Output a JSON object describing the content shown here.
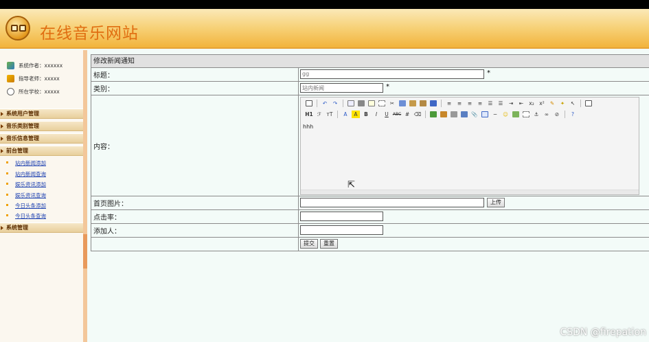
{
  "site": {
    "title": "在线音乐网站"
  },
  "sidebar": {
    "info": [
      {
        "text": "系统作者：xxxxxx",
        "icon": "person-icon"
      },
      {
        "text": "指导老师：xxxxx",
        "icon": "teacher-icon"
      },
      {
        "text": "所在学校：xxxxx",
        "icon": "school-icon"
      }
    ],
    "sections": [
      {
        "label": "系统用户管理"
      },
      {
        "label": "音乐类别管理"
      },
      {
        "label": "音乐信息管理"
      },
      {
        "label": "前台管理"
      },
      {
        "label": "系统管理"
      }
    ],
    "front_items": [
      {
        "label": "站内新闻添加"
      },
      {
        "label": "站内新闻查询"
      },
      {
        "label": "娱乐资讯添加"
      },
      {
        "label": "娱乐资讯查询"
      },
      {
        "label": "今日头条添加"
      },
      {
        "label": "今日头条查询"
      }
    ]
  },
  "form": {
    "title": "修改新闻通知",
    "fields": {
      "title_label": "标题：",
      "title_value": "gg",
      "category_label": "类别：",
      "category_value": "站内新闻",
      "content_label": "内容：",
      "content_value": "hhh",
      "image_label": "首页图片：",
      "image_value": "",
      "upload_button": "上传",
      "clicks_label": "点击率：",
      "clicks_value": "",
      "adder_label": "添加人：",
      "adder_value": "",
      "required_mark": "*"
    },
    "submit_button": "提交",
    "reset_button": "重置"
  },
  "editor": {
    "toolbar_row1": [
      "source-icon",
      "undo-icon",
      "redo-icon",
      "preview-icon",
      "print-icon",
      "template-icon",
      "select-all-icon",
      "cut-icon",
      "copy-icon",
      "paste-icon",
      "paste-text-icon",
      "paste-word-icon",
      "justify-left-icon",
      "justify-center-icon",
      "justify-right-icon",
      "justify-full-icon",
      "ordered-list-icon",
      "unordered-list-icon",
      "indent-icon",
      "outdent-icon",
      "subscript-icon",
      "superscript-icon",
      "clear-format-icon",
      "quick-format-icon",
      "select-icon",
      "fullscreen-icon"
    ],
    "toolbar_row2_text": {
      "heading": "H1",
      "font": "ℱ",
      "size": "тT",
      "forecolor": "A",
      "bgcolor": "A",
      "bold": "B",
      "italic": "I",
      "underline": "U",
      "strike": "ABC"
    },
    "toolbar_row2_icons": [
      "line-height-icon",
      "remove-format-icon",
      "image-icon",
      "multi-image-icon",
      "flash-icon",
      "media-icon",
      "attachment-icon",
      "table-icon",
      "hr-icon",
      "emoticon-icon",
      "map-icon",
      "pagebreak-icon",
      "anchor-icon",
      "link-icon",
      "unlink-icon",
      "help-icon"
    ]
  },
  "watermark": "CSDN @firepation"
}
